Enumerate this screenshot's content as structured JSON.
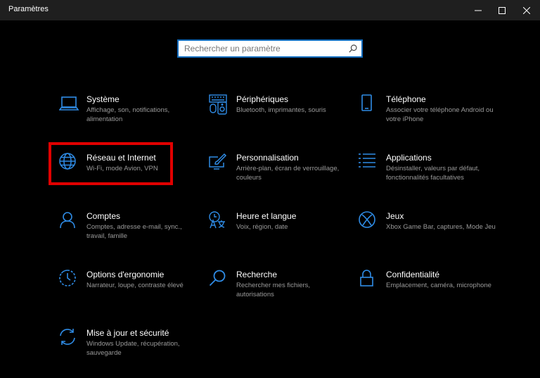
{
  "window": {
    "title": "Paramètres"
  },
  "search": {
    "placeholder": "Rechercher un paramètre",
    "value": ""
  },
  "colors": {
    "accent": "#0f6cbd",
    "icon": "#2f8ce6",
    "highlight": "#e10000",
    "background": "#000000",
    "titlebar": "#1f1f1f"
  },
  "tiles": [
    {
      "title": "Système",
      "desc": "Affichage, son, notifications, alimentation",
      "icon": "laptop-icon"
    },
    {
      "title": "Périphériques",
      "desc": "Bluetooth, imprimantes, souris",
      "icon": "devices-icon"
    },
    {
      "title": "Téléphone",
      "desc": "Associer votre téléphone Android ou votre iPhone",
      "icon": "phone-icon"
    },
    {
      "title": "Réseau et Internet",
      "desc": "Wi-Fi, mode Avion, VPN",
      "icon": "globe-icon"
    },
    {
      "title": "Personnalisation",
      "desc": "Arrière-plan, écran de verrouillage, couleurs",
      "icon": "personalization-icon"
    },
    {
      "title": "Applications",
      "desc": "Désinstaller, valeurs par défaut, fonctionnalités facultatives",
      "icon": "apps-list-icon"
    },
    {
      "title": "Comptes",
      "desc": "Comptes, adresse e-mail, sync., travail, famille",
      "icon": "person-icon"
    },
    {
      "title": "Heure et langue",
      "desc": "Voix, région, date",
      "icon": "time-language-icon"
    },
    {
      "title": "Jeux",
      "desc": "Xbox Game Bar, captures, Mode Jeu",
      "icon": "xbox-icon"
    },
    {
      "title": "Options d'ergonomie",
      "desc": "Narrateur, loupe, contraste élevé",
      "icon": "ease-of-access-icon"
    },
    {
      "title": "Recherche",
      "desc": "Rechercher mes fichiers, autorisations",
      "icon": "magnifier-icon"
    },
    {
      "title": "Confidentialité",
      "desc": "Emplacement, caméra, microphone",
      "icon": "lock-icon"
    },
    {
      "title": "Mise à jour et sécurité",
      "desc": "Windows Update, récupération, sauvegarde",
      "icon": "update-icon"
    }
  ]
}
